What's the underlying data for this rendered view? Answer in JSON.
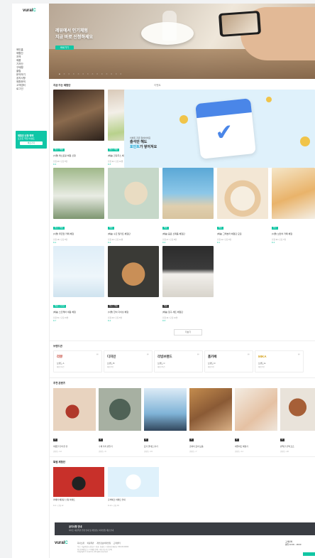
{
  "brand": {
    "logo_text": "vural",
    "logo_accent": "C",
    "accent_color": "#12c6a4"
  },
  "sidebar": {
    "items": [
      "메인홈",
      "체험단",
      "지역",
      "제품",
      "기자단",
      "구매평",
      "클립",
      "문의하기",
      "공지사항",
      "제휴문의",
      "고객센터",
      "로그인"
    ],
    "promo_title": "체험단 신청 혜택",
    "promo_sub": "포인트 적립 이벤트",
    "promo_button": "바로가기"
  },
  "hero": {
    "title_line1": "레뷰에서 인기체험",
    "title_line2": "지금 바로 신청하세요",
    "cta": "바로가기",
    "dots": "● ○ ○ ○ ○ ○ ○ ○ ○ ○ ○ ○ ○ ○"
  },
  "sections": {
    "featured": "지금 뜨는 체험단",
    "banner_label": "이벤트",
    "brands": "브랜드관",
    "picks": "추천 콘텐츠",
    "special": "특별 체험단"
  },
  "featured_cards": [
    {
      "badge": "방문 • 배송",
      "name": "[서울] 레스토랑 체험 신청",
      "meta": "신청 20 / 모집 5명",
      "meta2": "D-3"
    },
    {
      "badge": "방문 • 배송",
      "name": "[배송] 건강주스 체험단 모집",
      "meta": "신청 32 / 모집 10명",
      "meta2": "D-5"
    },
    {
      "badge": "방문 • 배송",
      "name": "[서울] 루프탑 카페 체험",
      "meta": "신청 18 / 모집 5명",
      "meta2": "D-2"
    },
    {
      "badge": "배송",
      "name": "[배송] 수프 밀키트 체험단",
      "meta": "신청 40 / 모집 12명",
      "meta2": "D-4"
    },
    {
      "badge": "배송",
      "name": "[배송] 음료 신제품 체험단",
      "meta": "신청 27 / 모집 8명",
      "meta2": "D-6"
    },
    {
      "badge": "배송",
      "name": "[배송] 그래놀라 체험단 모집",
      "meta": "신청 22 / 모집 6명",
      "meta2": "D-1"
    },
    {
      "badge": "방문",
      "name": "[서울] 브런치 카페 체험",
      "meta": "신청 35 / 모집 7명",
      "meta2": "D-3"
    },
    {
      "badge": "배송 • 기자단",
      "name": "[배송] 스킨케어 세럼 체험",
      "meta": "신청 51 / 모집 15명",
      "meta2": "D-7"
    },
    {
      "badge": "방문 • 배송",
      "name": "[서울] 한식 다이닝 체험",
      "meta": "신청 29 / 모집 5명",
      "meta2": "D-2"
    },
    {
      "badge": "배송",
      "name": "[배송] 침구 세트 체험단",
      "meta": "신청 44 / 모집 10명",
      "meta2": "D-5"
    }
  ],
  "banner": {
    "small": "이벤트 지금 참여하세요",
    "line1": "출석만 해도",
    "highlight": "포인트",
    "line2_suffix": "가 쌓여져요"
  },
  "more_button": "더보기",
  "brands": [
    {
      "logo": "리뷰",
      "name": "브랜드 A",
      "sub": "체험 12건"
    },
    {
      "logo": "디자인",
      "name": "브랜드 B",
      "sub": "체험 8건"
    },
    {
      "logo": "리빙브랜드",
      "name": "브랜드 C",
      "sub": "체험 15건"
    },
    {
      "logo": "홈카페",
      "name": "브랜드 D",
      "sub": "체험 6건"
    },
    {
      "logo": "MIKA",
      "name": "브랜드 E",
      "sub": "체험 9건"
    }
  ],
  "picks": [
    {
      "name": "따뜻한 홍차 한 잔",
      "meta": "콘텐츠 • 12"
    },
    {
      "name": "수제 쿠키 만들기",
      "meta": "콘텐츠 • 9"
    },
    {
      "name": "요가 클래스 후기",
      "meta": "콘텐츠 • 15"
    },
    {
      "name": "홈파티 요리 모음",
      "meta": "콘텐츠 • 7"
    },
    {
      "name": "네일아트 체험기",
      "meta": "콘텐츠 • 11"
    },
    {
      "name": "반려견 산책 코스",
      "meta": "콘텐츠 • 20"
    }
  ],
  "special": [
    {
      "name": "카메라 체험단 신청 이벤트",
      "meta": "D-3 • 신청 12"
    },
    {
      "name": "출석체크 이벤트 안내",
      "meta": "D-10 • 신청 40"
    }
  ],
  "notice": {
    "title": "공지사항 안내",
    "text": "서비스 이용약관 변경 안내 및 개인정보 처리방침 개정 안내"
  },
  "footer": {
    "links": "회사소개 이용약관 개인정보처리방침 고객센터",
    "info1": "주소: 서울특별시 강남구 • 대표: 홍길동 • 사업자등록번호: 000-00-00000",
    "info2": "통신판매업신고 • 이메일 문의 • 제휴 및 광고 문의",
    "copyright": "Copyright © vural Co. All rights reserved.",
    "cs_title": "고객센터",
    "cs_time": "평일 10:00 - 18:00"
  }
}
